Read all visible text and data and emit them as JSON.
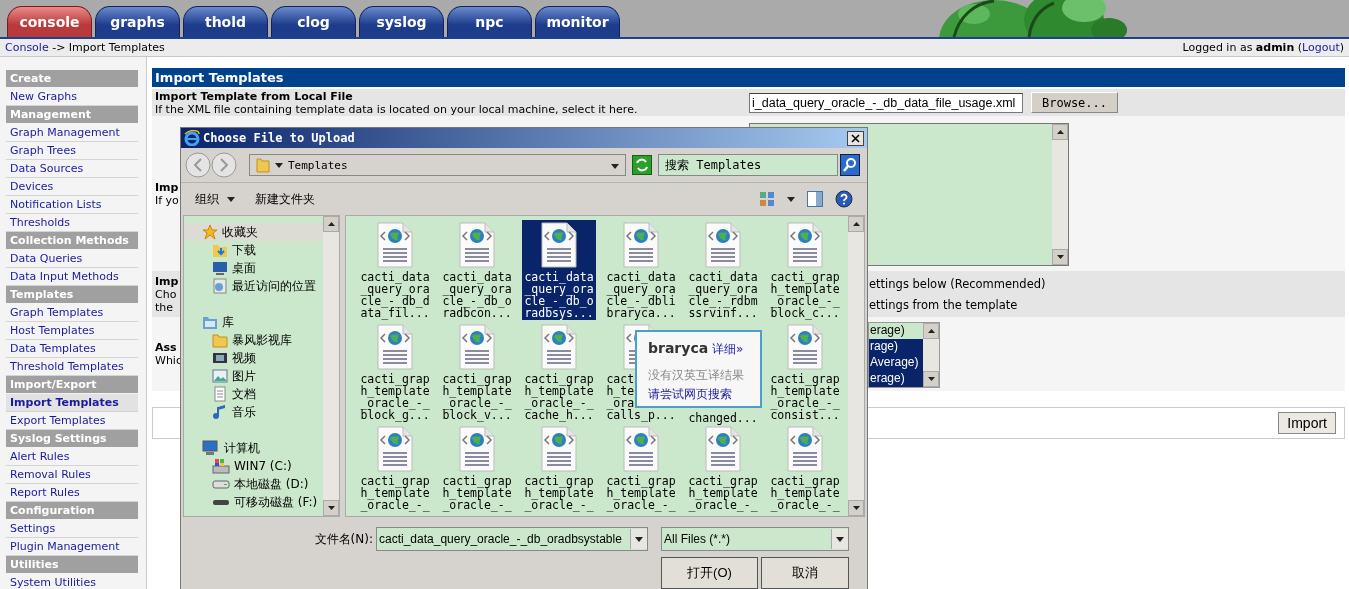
{
  "tabs": [
    {
      "label": "console",
      "selected": true
    },
    {
      "label": "graphs",
      "selected": false
    },
    {
      "label": "thold",
      "selected": false
    },
    {
      "label": "clog",
      "selected": false
    },
    {
      "label": "syslog",
      "selected": false
    },
    {
      "label": "npc",
      "selected": false
    },
    {
      "label": "monitor",
      "selected": false
    }
  ],
  "breadcrumb": {
    "link": "Console",
    "text": "-> Import Templates"
  },
  "login_status": {
    "before": "Logged in as **admin** (",
    "link": "Logout",
    "after": ")"
  },
  "sidebar": [
    {
      "title": "Create",
      "items": [
        {
          "label": "New Graphs",
          "selected": false
        }
      ]
    },
    {
      "title": "Management",
      "items": [
        {
          "label": "Graph Management",
          "selected": false
        },
        {
          "label": "Graph Trees",
          "selected": false
        },
        {
          "label": "Data Sources",
          "selected": false
        },
        {
          "label": "Devices",
          "selected": false
        },
        {
          "label": "Notification Lists",
          "selected": false
        },
        {
          "label": "Thresholds",
          "selected": false
        }
      ]
    },
    {
      "title": "Collection Methods",
      "items": [
        {
          "label": "Data Queries",
          "selected": false
        },
        {
          "label": "Data Input Methods",
          "selected": false
        }
      ]
    },
    {
      "title": "Templates",
      "items": [
        {
          "label": "Graph Templates",
          "selected": false
        },
        {
          "label": "Host Templates",
          "selected": false
        },
        {
          "label": "Data Templates",
          "selected": false
        },
        {
          "label": "Threshold Templates",
          "selected": false
        }
      ]
    },
    {
      "title": "Import/Export",
      "items": [
        {
          "label": "Import Templates",
          "selected": true
        },
        {
          "label": "Export Templates",
          "selected": false
        }
      ]
    },
    {
      "title": "Syslog Settings",
      "items": [
        {
          "label": "Alert Rules",
          "selected": false
        },
        {
          "label": "Removal Rules",
          "selected": false
        },
        {
          "label": "Report Rules",
          "selected": false
        }
      ]
    },
    {
      "title": "Configuration",
      "items": [
        {
          "label": "Settings",
          "selected": false
        },
        {
          "label": "Plugin Management",
          "selected": false
        }
      ]
    },
    {
      "title": "Utilities",
      "items": [
        {
          "label": "System Utilities",
          "selected": false
        }
      ]
    }
  ],
  "form": {
    "title": "Import Templates",
    "rows": [
      {
        "kind": "file",
        "title": "Import Template from Local File",
        "description": [
          "If the XML file containing template data is located on your local machine, select it here."
        ],
        "value": "i_data_query_oracle_-_db_data_file_usage.xml",
        "button": "Browse..."
      },
      {
        "kind": "textarea",
        "title": "Imp",
        "description": [
          "If yo"
        ]
      },
      {
        "kind": "radios",
        "title": "Imp",
        "description": [
          "Cho",
          "the"
        ],
        "options": [
          "ettings below (Recommended)",
          "ettings from the template"
        ]
      },
      {
        "kind": "list",
        "title": "Ass",
        "description": [
          "Whic"
        ],
        "options": [
          {
            "label": "erage)",
            "selected": false
          },
          {
            "label": "rage)",
            "selected": true
          },
          {
            "label": "Average)",
            "selected": true
          },
          {
            "label": "erage)",
            "selected": true
          }
        ]
      }
    ],
    "button": "Import"
  },
  "dialog": {
    "title": "Choose File to Upload",
    "path": "Templates",
    "search_placeholder": "搜索 Templates",
    "organize": "组织",
    "new_folder": "新建文件夹",
    "nav": [
      {
        "label": "收藏夹",
        "selected": true,
        "children": [
          {
            "label": "下载",
            "selected": false
          },
          {
            "label": "桌面",
            "selected": false
          },
          {
            "label": "最近访问的位置",
            "selected": false
          }
        ]
      },
      {
        "label": "库",
        "selected": false,
        "children": [
          {
            "label": "暴风影视库",
            "selected": false
          },
          {
            "label": "视频",
            "selected": false
          },
          {
            "label": "图片",
            "selected": false
          },
          {
            "label": "文档",
            "selected": false
          },
          {
            "label": "音乐",
            "selected": false
          }
        ]
      },
      {
        "label": "计算机",
        "selected": false,
        "children": [
          {
            "label": "WIN7 (C:)",
            "selected": false
          },
          {
            "label": "本地磁盘 (D:)",
            "selected": false
          },
          {
            "label": "可移动磁盘 (F:)",
            "selected": false
          }
        ]
      }
    ],
    "files": [
      {
        "kind": "file",
        "selected": false,
        "lines": [
          "cacti_data",
          "_query_ora",
          "cle_-_db_d",
          "ata_fil..."
        ]
      },
      {
        "kind": "file",
        "selected": false,
        "lines": [
          "cacti_data",
          "_query_ora",
          "cle_-_db_o",
          "radbcon..."
        ]
      },
      {
        "kind": "file",
        "selected": true,
        "lines": [
          "cacti_data",
          "_query_ora",
          "cle_-_db_o",
          "radbsys..."
        ]
      },
      {
        "kind": "file",
        "selected": false,
        "lines": [
          "cacti_data",
          "_query_ora",
          "cle_-_dbli",
          "braryca..."
        ]
      },
      {
        "kind": "file",
        "selected": false,
        "lines": [
          "cacti_data",
          "_query_ora",
          "cle_-_rdbm",
          "ssrvinf..."
        ]
      },
      {
        "kind": "file",
        "selected": false,
        "lines": [
          "cacti_grap",
          "h_template",
          "_oracle_-_",
          "block_c..."
        ]
      },
      {
        "kind": "file",
        "selected": false,
        "lines": [
          "cacti_grap",
          "h_template",
          "_oracle_-_",
          "block_g..."
        ]
      },
      {
        "kind": "file",
        "selected": false,
        "lines": [
          "cacti_grap",
          "h_template",
          "_oracle_-_",
          "block_v..."
        ]
      },
      {
        "kind": "file",
        "selected": false,
        "lines": [
          "cacti_grap",
          "h_template",
          "_oracle_-_",
          "cache_h..."
        ]
      },
      {
        "kind": "file",
        "selected": false,
        "lines": [
          "cact",
          "h_te",
          "_ora",
          "calls_p..."
        ]
      },
      {
        "kind": "covered",
        "selected": false,
        "lines": [
          "changed..."
        ]
      },
      {
        "kind": "file",
        "selected": false,
        "lines": [
          "cacti_grap",
          "h_template",
          "_oracle_-_",
          "consist..."
        ]
      },
      {
        "kind": "file",
        "selected": false,
        "lines": [
          "cacti_grap",
          "h_template",
          "_oracle_-_"
        ]
      },
      {
        "kind": "file",
        "selected": false,
        "lines": [
          "cacti_grap",
          "h_template",
          "_oracle_-_"
        ]
      },
      {
        "kind": "file",
        "selected": false,
        "lines": [
          "cacti_grap",
          "h_template",
          "_oracle_-_"
        ]
      },
      {
        "kind": "file",
        "selected": false,
        "lines": [
          "cacti_grap",
          "h_template",
          "_oracle_-_"
        ]
      },
      {
        "kind": "file",
        "selected": false,
        "lines": [
          "cacti_grap",
          "h_template",
          "_oracle_-_"
        ]
      },
      {
        "kind": "file",
        "selected": false,
        "lines": [
          "cacti_grap",
          "h_template",
          "_oracle_-_"
        ]
      }
    ],
    "filename_label": "文件名(N):",
    "filename": "cacti_data_query_oracle_-_db_oradbsystable",
    "filter": "All Files (*.*)",
    "open_button": "打开(O)",
    "cancel_button": "取消"
  },
  "tooltip": {
    "word": "braryca",
    "detail_link": "详细»",
    "message": "没有汉英互译结果",
    "search_link": "请尝试网页搜索"
  }
}
